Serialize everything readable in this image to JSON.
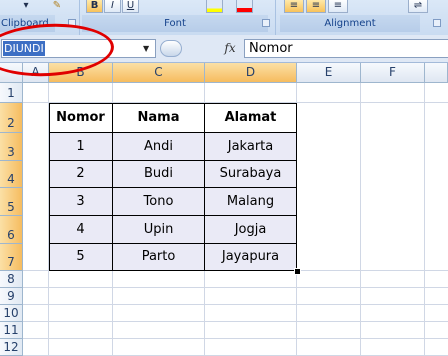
{
  "ribbon": {
    "clipboard_label": "Clipboard",
    "font_label": "Font",
    "alignment_label": "Alignment",
    "font_buttons": [
      "B",
      "I",
      "U"
    ],
    "icons": [
      "paste-dropdown-icon",
      "format-painter-icon",
      "fill-color-icon",
      "font-color-icon",
      "align-top-icon",
      "align-middle-icon",
      "align-bottom-icon",
      "wrap-text-icon"
    ],
    "accent_colors": {
      "fill": "#ffff00",
      "font": "#ff0000",
      "selected_header": "#f6bc5f"
    }
  },
  "formula_bar": {
    "name_box_value": "DIUNDI",
    "fx_label": "fx",
    "formula_value": "Nomor"
  },
  "grid": {
    "columns": [
      "A",
      "B",
      "C",
      "D",
      "E",
      "F"
    ],
    "rows": [
      "1",
      "2",
      "3",
      "4",
      "5",
      "6",
      "7",
      "8",
      "9",
      "10",
      "11",
      "12"
    ]
  },
  "table": {
    "headers": [
      "Nomor",
      "Nama",
      "Alamat"
    ],
    "rows": [
      [
        "1",
        "Andi",
        "Jakarta"
      ],
      [
        "2",
        "Budi",
        "Surabaya"
      ],
      [
        "3",
        "Tono",
        "Malang"
      ],
      [
        "4",
        "Upin",
        "Jogja"
      ],
      [
        "5",
        "Parto",
        "Jayapura"
      ]
    ]
  },
  "annotation": {
    "circle_color": "#e00000",
    "target": "name-box"
  }
}
